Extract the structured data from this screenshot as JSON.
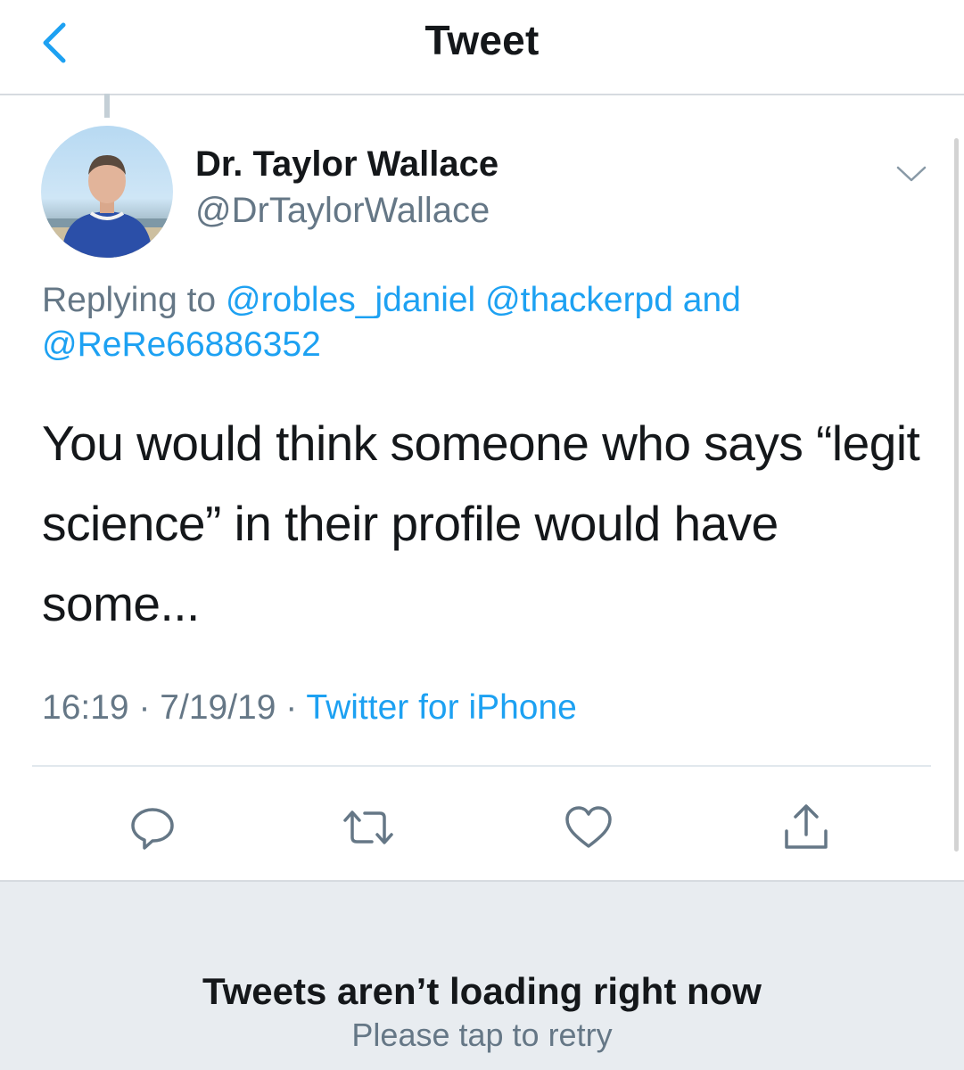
{
  "header": {
    "title": "Tweet"
  },
  "tweet": {
    "display_name": "Dr. Taylor Wallace",
    "handle": "@DrTaylorWallace",
    "replying_label": "Replying to",
    "mentions": [
      "@robles_jdaniel",
      "@thackerpd",
      "@ReRe66886352"
    ],
    "mention_joiner": "and",
    "text": "You would think someone who says “legit science” in their profile would have some...",
    "time": "16:19",
    "date": "7/19/19",
    "separator": "·",
    "source": "Twitter for iPhone"
  },
  "actions": {
    "reply_icon": "reply-icon",
    "retweet_icon": "retweet-icon",
    "like_icon": "heart-icon",
    "share_icon": "share-icon"
  },
  "error": {
    "title": "Tweets aren’t loading right now",
    "subtitle": "Please tap to retry"
  },
  "colors": {
    "accent": "#1da1f2",
    "text_primary": "#14171a",
    "text_secondary": "#657786",
    "panel_bg": "#e8ecf0"
  }
}
